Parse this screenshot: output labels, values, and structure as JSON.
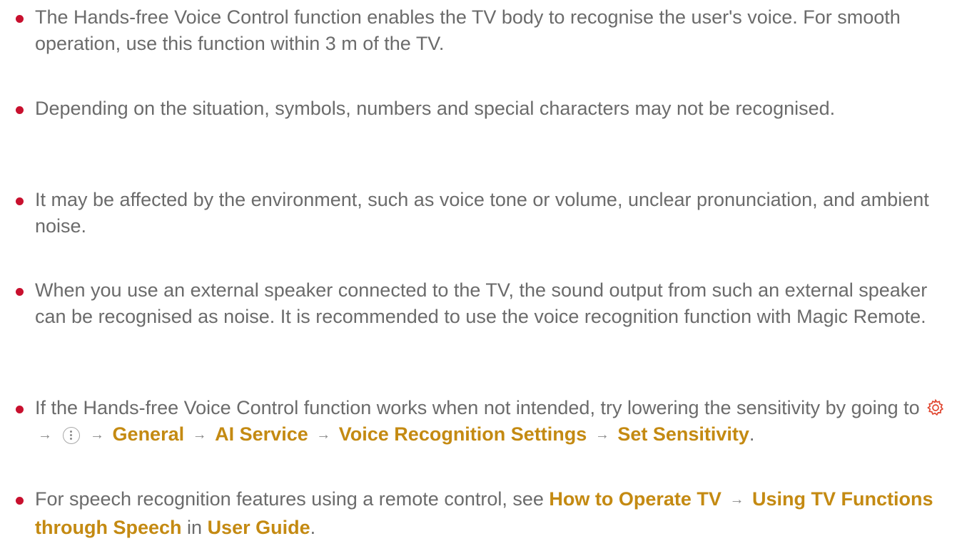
{
  "bullets": {
    "b1": "The Hands-free Voice Control function enables the TV body to recognise the user's voice. For smooth operation, use this function within 3 m of the TV.",
    "b2": "Depending on the situation, symbols, numbers and special characters may not be recognised.",
    "b3": "It may be affected by the environment, such as voice tone or volume, unclear pronunciation, and ambient noise.",
    "b4": "When you use an external speaker connected to the TV, the sound output from such an external speaker can be recognised as noise. It is recommended to use the voice recognition function with Magic Remote.",
    "b5": {
      "text_before": "If the Hands-free Voice Control function works when not intended, try lowering the sensitivity by going to",
      "arrow": "→",
      "path": [
        "General",
        "AI Service",
        "Voice Recognition Settings",
        "Set Sensitivity"
      ],
      "text_after": "."
    },
    "b6": {
      "text_before": "For speech recognition features using a remote control, see",
      "arrow": "→",
      "link1": "How to Operate TV",
      "link2": "Using TV Functions through Speech",
      "text_mid": "in",
      "link3": "User Guide",
      "text_after": "."
    }
  },
  "icons": {
    "settings": "gear-icon",
    "more": "more-vertical-icon",
    "bullet": "red-dot"
  },
  "colors": {
    "text": "#6b6b6b",
    "emphasis": "#c48a12",
    "bullet": "#c8102e",
    "gear": "#e0452f"
  }
}
